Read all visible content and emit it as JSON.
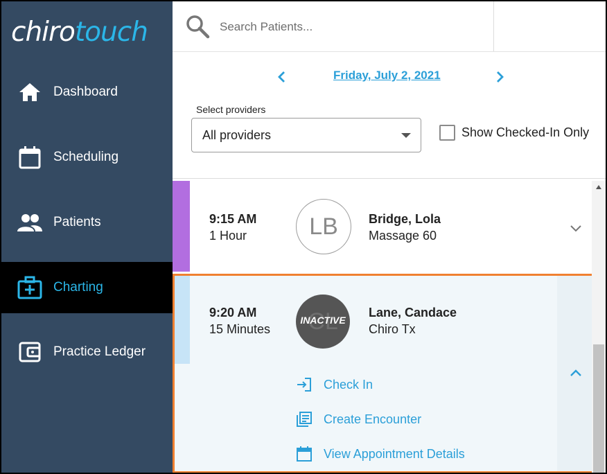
{
  "logo": {
    "part1": "chiro",
    "part2": "touch"
  },
  "sidebar": {
    "items": [
      {
        "label": "Dashboard",
        "icon": "home-icon",
        "active": false
      },
      {
        "label": "Scheduling",
        "icon": "calendar-icon",
        "active": false
      },
      {
        "label": "Patients",
        "icon": "people-icon",
        "active": false
      },
      {
        "label": "Charting",
        "icon": "medical-kit-icon",
        "active": true
      },
      {
        "label": "Practice Ledger",
        "icon": "wallet-icon",
        "active": false
      }
    ]
  },
  "search": {
    "placeholder": "Search Patients..."
  },
  "date_nav": {
    "date": "Friday, July 2, 2021"
  },
  "filters": {
    "providers_label": "Select providers",
    "providers_value": "All providers",
    "checked_in_label": "Show Checked-In Only",
    "checked_in_checked": false
  },
  "appointments": [
    {
      "time": "9:15 AM",
      "duration": "1 Hour",
      "initials": "LB",
      "name": "Bridge, Lola",
      "type": "Massage 60",
      "color": "#b26ee0"
    },
    {
      "time": "9:20 AM",
      "duration": "15 Minutes",
      "initials": "CL",
      "status": "INACTIVE",
      "name": "Lane, Candace",
      "type": "Chiro Tx",
      "color": "#c7e4f7",
      "actions": [
        {
          "label": "Check In",
          "icon": "check-in-icon"
        },
        {
          "label": "Create Encounter",
          "icon": "encounter-icon"
        },
        {
          "label": "View Appointment Details",
          "icon": "calendar-icon"
        }
      ]
    }
  ],
  "colors": {
    "sidebar_bg": "#344a62",
    "accent": "#2b9fd8",
    "highlight": "#f08030"
  }
}
